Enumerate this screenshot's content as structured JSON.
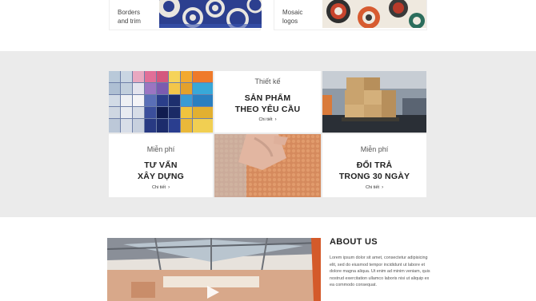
{
  "top_categories": [
    {
      "label": "Borders\nand trim"
    },
    {
      "label": "Mosaic\nlogos"
    }
  ],
  "services": [
    {
      "eyebrow": "Thiết kế",
      "title_line1": "SẢN PHẨM",
      "title_line2": "THEO YÊU CẦU",
      "link": "Chi tiết"
    },
    {
      "eyebrow": "Miễn phí",
      "title_line1": "TƯ VẤN",
      "title_line2": "XÂY DỰNG",
      "link": "Chi tiết"
    },
    {
      "eyebrow": "Miễn phí",
      "title_line1": "ĐỔI TRẢ",
      "title_line2": "TRONG 30 NGÀY",
      "link": "Chi tiết"
    }
  ],
  "about": {
    "title": "ABOUT US",
    "body": "Lorem ipsum dolor sit amet, consectetur adipisicing elit, sed do eiusmod tempor incididunt ut labore et dolore magna aliqua. Ut enim ad minim veniam, quis nostrud exercitation ullamco laboris nisi ut aliquip ex ea commodo consequat."
  },
  "colors": {
    "band_bg": "#ebebeb",
    "tile_bg": "#ffffff",
    "text_dark": "#222222"
  }
}
